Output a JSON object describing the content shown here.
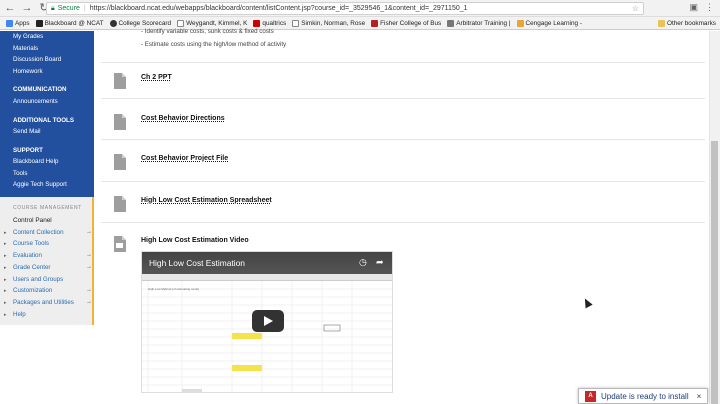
{
  "browser": {
    "url_secure_label": "Secure",
    "url": "https://blackboard.ncat.edu/webapps/blackboard/content/listContent.jsp?course_id=_3529546_1&content_id=_2971150_1",
    "bookmarks": [
      {
        "label": "Apps",
        "color": "#4285f4"
      },
      {
        "label": "Blackboard @ NCAT",
        "color": "#222222"
      },
      {
        "label": "College Scorecard",
        "color": "#333333"
      },
      {
        "label": "Weygandt, Kimmel, K",
        "color": "#666666"
      },
      {
        "label": "qualtrics",
        "color": "#cc0000"
      },
      {
        "label": "Simkin, Norman, Rose",
        "color": "#666666"
      },
      {
        "label": "Fisher College of Bus",
        "color": "#b22222"
      },
      {
        "label": "Arbitrator Training |",
        "color": "#777777"
      },
      {
        "label": "Cengage Learning -",
        "color": "#e8a53a"
      }
    ],
    "other_bookmarks": "Other bookmarks"
  },
  "sidebar": {
    "items_top": [
      "My Grades",
      "Materials",
      "Discussion Board",
      "Homework"
    ],
    "communication_header": "COMMUNICATION",
    "communication_items": [
      "Announcements"
    ],
    "additional_header": "ADDITIONAL TOOLS",
    "additional_items": [
      "Send Mail"
    ],
    "support_header": "SUPPORT",
    "support_items": [
      "Blackboard Help",
      "Tools",
      "Aggie Tech Support"
    ],
    "course_management_title": "COURSE MANAGEMENT",
    "control_panel": "Control Panel",
    "control_items": [
      "Content Collection",
      "Course Tools",
      "Evaluation",
      "Grade Center",
      "Users and Groups",
      "Customization",
      "Packages and Utilities",
      "Help"
    ]
  },
  "content": {
    "intro_lines": [
      "- Identify variable costs, sunk costs & fixed costs",
      "- Estimate costs using the high/low method of activity"
    ],
    "items": [
      "Ch 2 PPT",
      "Cost Behavior Directions",
      "Cost Behavior Project File",
      "High Low Cost Estimation Spreadsheet",
      "High Low Cost Estimation Video"
    ]
  },
  "video": {
    "title": "High Low Cost Estimation",
    "sheet_heading": "High Low Method (of estimating costs)"
  },
  "notification": {
    "text": "Update is ready to install"
  }
}
